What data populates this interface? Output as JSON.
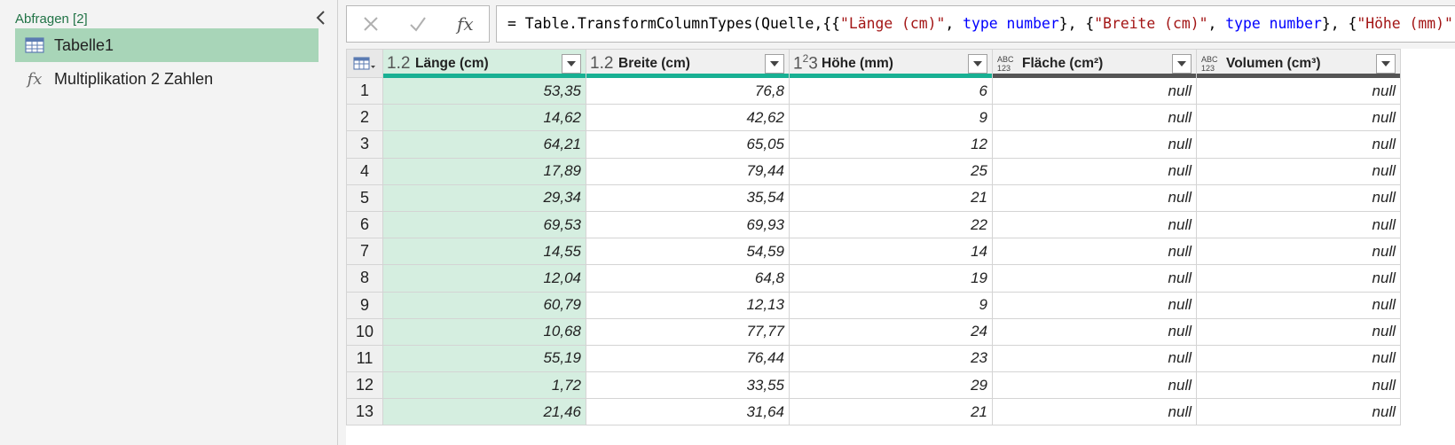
{
  "queries": {
    "header": "Abfragen [2]",
    "items": [
      {
        "label": "Tabelle1",
        "icon": "table-icon"
      },
      {
        "label": "Multiplikation 2 Zahlen",
        "icon": "function-icon"
      }
    ]
  },
  "formula": {
    "cancel_icon": "cancel-icon",
    "confirm_icon": "confirm-icon",
    "fx_label": "fx",
    "parts": [
      {
        "t": "= Table.TransformColumnTypes(Quelle,{{",
        "c": ""
      },
      {
        "t": "\"Länge (cm)\"",
        "c": "str"
      },
      {
        "t": ", ",
        "c": ""
      },
      {
        "t": "type",
        "c": "kw"
      },
      {
        "t": " ",
        "c": ""
      },
      {
        "t": "number",
        "c": "kw"
      },
      {
        "t": "}, {",
        "c": ""
      },
      {
        "t": "\"Breite (cm)\"",
        "c": "str"
      },
      {
        "t": ", ",
        "c": ""
      },
      {
        "t": "type",
        "c": "kw"
      },
      {
        "t": " ",
        "c": ""
      },
      {
        "t": "number",
        "c": "kw"
      },
      {
        "t": "}, {",
        "c": ""
      },
      {
        "t": "\"Höhe (mm)\"",
        "c": "str"
      },
      {
        "t": ", ",
        "c": ""
      }
    ]
  },
  "colors": {
    "accent": "#217346",
    "selected_query": "#a8d5b8",
    "quality_ok": "#18b093",
    "quality_null": "#555555"
  },
  "grid": {
    "columns": [
      {
        "label": "Länge (cm)",
        "type": "1.2",
        "quality": "ok",
        "selected": true
      },
      {
        "label": "Breite (cm)",
        "type": "1.2",
        "quality": "ok",
        "selected": false
      },
      {
        "label": "Höhe (mm)",
        "type": "1²3",
        "quality": "ok",
        "selected": false
      },
      {
        "label": "Fläche (cm²)",
        "type": "ABC123",
        "quality": "null",
        "selected": false
      },
      {
        "label": "Volumen (cm³)",
        "type": "ABC123",
        "quality": "null",
        "selected": false
      }
    ],
    "rows": [
      [
        "1",
        "53,35",
        "76,8",
        "6",
        "null",
        "null"
      ],
      [
        "2",
        "14,62",
        "42,62",
        "9",
        "null",
        "null"
      ],
      [
        "3",
        "64,21",
        "65,05",
        "12",
        "null",
        "null"
      ],
      [
        "4",
        "17,89",
        "79,44",
        "25",
        "null",
        "null"
      ],
      [
        "5",
        "29,34",
        "35,54",
        "21",
        "null",
        "null"
      ],
      [
        "6",
        "69,53",
        "69,93",
        "22",
        "null",
        "null"
      ],
      [
        "7",
        "14,55",
        "54,59",
        "14",
        "null",
        "null"
      ],
      [
        "8",
        "12,04",
        "64,8",
        "19",
        "null",
        "null"
      ],
      [
        "9",
        "60,79",
        "12,13",
        "9",
        "null",
        "null"
      ],
      [
        "10",
        "10,68",
        "77,77",
        "24",
        "null",
        "null"
      ],
      [
        "11",
        "55,19",
        "76,44",
        "23",
        "null",
        "null"
      ],
      [
        "12",
        "1,72",
        "33,55",
        "29",
        "null",
        "null"
      ],
      [
        "13",
        "21,46",
        "31,64",
        "21",
        "null",
        "null"
      ]
    ]
  }
}
